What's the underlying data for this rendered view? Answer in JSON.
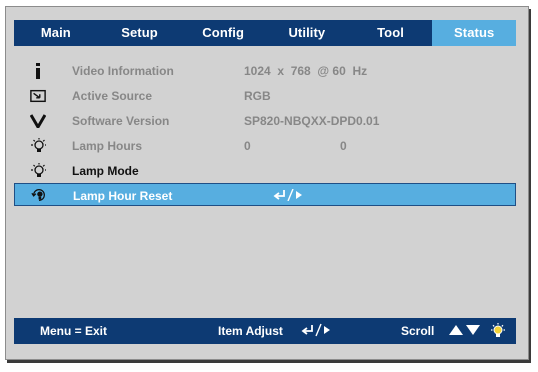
{
  "tabs": [
    {
      "label": "Main",
      "active": false
    },
    {
      "label": "Setup",
      "active": false
    },
    {
      "label": "Config",
      "active": false
    },
    {
      "label": "Utility",
      "active": false
    },
    {
      "label": "Tool",
      "active": false
    },
    {
      "label": "Status",
      "active": true
    }
  ],
  "rows": [
    {
      "icon": "info-icon",
      "label": "Video Information",
      "value": "1024  x  768  @ 60  Hz",
      "enabled": false
    },
    {
      "icon": "input-source-icon",
      "label": "Active Source",
      "value": "RGB",
      "enabled": false
    },
    {
      "icon": "software-v-icon",
      "label": "Software Version",
      "value": "SP820-NBQXX-DPD0.01",
      "enabled": false
    },
    {
      "icon": "lamp-bulb-icon",
      "label": "Lamp Hours",
      "value": "0",
      "value2": "0",
      "enabled": false
    },
    {
      "icon": "lamp-bulb-icon",
      "label": "Lamp Mode",
      "value": "",
      "enabled": true
    },
    {
      "icon": "lamp-reset-icon",
      "label": "Lamp Hour Reset",
      "value": "enter-arrow",
      "enabled": true,
      "selected": true
    }
  ],
  "footer": {
    "exit": "Menu = Exit",
    "adjust": "Item Adjust",
    "scroll": "Scroll"
  },
  "colors": {
    "bar": "#0d3a73",
    "highlight": "#57aee0",
    "panel": "#d2d2d2",
    "disabled_text": "#878787"
  }
}
